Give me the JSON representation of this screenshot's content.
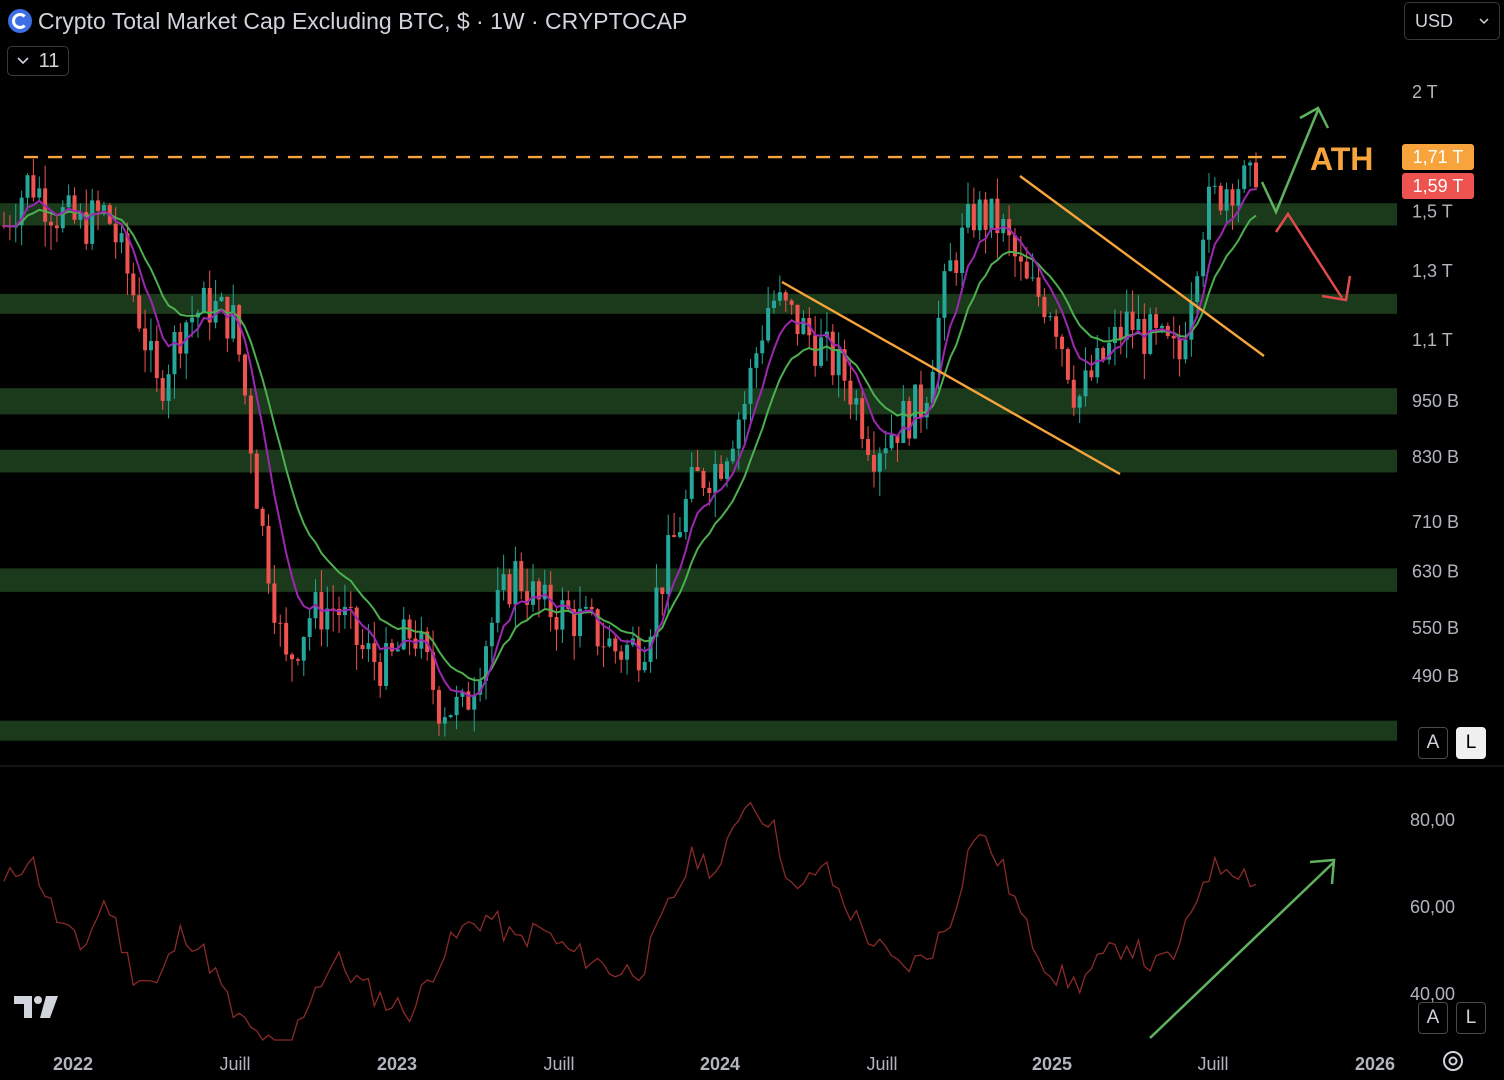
{
  "header": {
    "title": "Crypto Total Market Cap Excluding BTC, $ · 1W · CRYPTOCAP",
    "collapse_count": "11",
    "currency": "USD"
  },
  "icons": {
    "logo": "cryptocap-logo-icon",
    "chevron": "chevron-down-icon",
    "tv": "tradingview-logo-icon",
    "settings": "gear-icon"
  },
  "buttons": {
    "auto": "A",
    "log": "L"
  },
  "colors": {
    "up": "#26a69a",
    "down": "#ef5350",
    "ema_fast": "#9c27b0",
    "ema_slow": "#4caf50",
    "zone": "#1b3a1b",
    "ath": "#f7a43c",
    "rsi": "#8a2a2a",
    "arrow_up": "#5fb35f",
    "arrow_down": "#e04a4a"
  },
  "chart_data": [
    {
      "type": "candlestick",
      "title": "Crypto Total Market Cap Excluding BTC",
      "scale": "log",
      "timeframe": "1W",
      "x_labels": [
        "2022",
        "Juill",
        "2023",
        "Juill",
        "2024",
        "Juill",
        "2025",
        "Juill",
        "2026"
      ],
      "y_ticks": [
        "2 T",
        "1,5 T",
        "1,3 T",
        "1,1 T",
        "950 B",
        "830 B",
        "710 B",
        "630 B",
        "550 B",
        "490 B"
      ],
      "price_labels": {
        "ath": "1,71 T",
        "last": "1,59 T"
      },
      "annotations": {
        "ath_label": "ATH"
      },
      "close_path_T": [
        1.45,
        1.62,
        1.5,
        1.45,
        1.5,
        1.25,
        0.97,
        1.15,
        1.2,
        1.15,
        0.72,
        0.5,
        0.57,
        0.58,
        0.52,
        0.5,
        0.55,
        0.46,
        0.45,
        0.55,
        0.63,
        0.58,
        0.57,
        0.55,
        0.52,
        0.53,
        0.65,
        0.78,
        0.82,
        0.95,
        1.22,
        1.15,
        1.08,
        1.0,
        0.85,
        0.9,
        0.95,
        1.3,
        1.5,
        1.45,
        1.25,
        1.2,
        0.95,
        1.05,
        1.15,
        1.1,
        1.05,
        1.5,
        1.62,
        1.59
      ],
      "support_zones_T": [
        [
          1.45,
          1.53
        ],
        [
          1.18,
          1.23
        ],
        [
          0.92,
          0.98
        ],
        [
          0.8,
          0.845
        ],
        [
          0.6,
          0.635
        ],
        [
          0.42,
          0.44
        ]
      ],
      "ath_level_T": 1.71,
      "last_close_T": 1.59
    },
    {
      "type": "line",
      "title": "RSI",
      "y_ticks": [
        "80,00",
        "60,00",
        "40,00"
      ],
      "values": [
        65,
        72,
        58,
        50,
        62,
        45,
        42,
        55,
        48,
        35,
        30,
        25,
        40,
        48,
        42,
        38,
        36,
        48,
        55,
        58,
        52,
        55,
        50,
        48,
        45,
        46,
        60,
        72,
        68,
        85,
        80,
        62,
        70,
        60,
        52,
        46,
        48,
        56,
        78,
        70,
        55,
        45,
        42,
        48,
        52,
        46,
        50,
        68,
        70,
        66
      ]
    }
  ]
}
